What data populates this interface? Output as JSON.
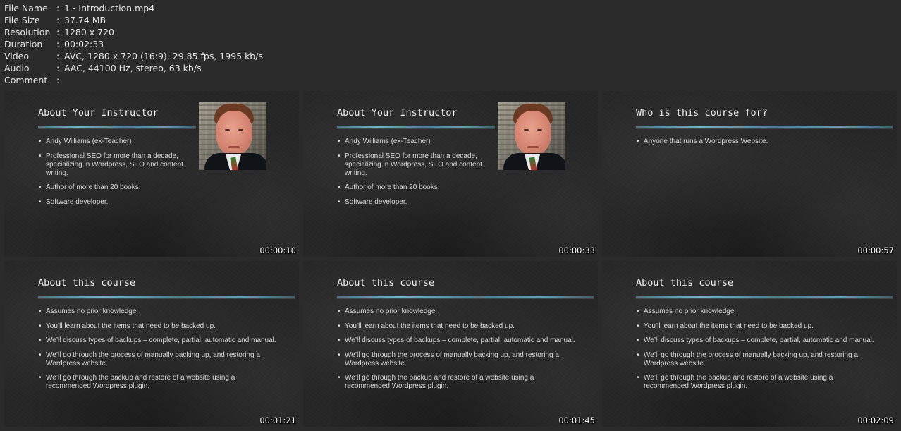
{
  "file_info": [
    {
      "label": "File Name",
      "value": "1 - Introduction.mp4"
    },
    {
      "label": "File Size",
      "value": "37.74 MB"
    },
    {
      "label": "Resolution",
      "value": "1280 x 720"
    },
    {
      "label": "Duration",
      "value": "00:02:33"
    },
    {
      "label": "Video",
      "value": "AVC, 1280 x 720 (16:9), 29.85 fps, 1995 kb/s"
    },
    {
      "label": "Audio",
      "value": "AAC, 44100 Hz, stereo, 63 kb/s"
    },
    {
      "label": "Comment",
      "value": ""
    }
  ],
  "separator": ":",
  "thumbnails": [
    {
      "timestamp": "00:00:10",
      "title": "About Your Instructor",
      "bullets": [
        "Andy Williams (ex-Teacher)",
        "Professional SEO for more than a decade, specializing in Wordpress, SEO and content writing.",
        "Author of more than 20 books.",
        "Software developer."
      ]
    },
    {
      "timestamp": "00:00:33",
      "title": "About Your Instructor",
      "bullets": [
        "Andy Williams (ex-Teacher)",
        "Professional SEO for more than a decade, specializing in Wordpress, SEO and content writing.",
        "Author of more than 20 books.",
        "Software developer."
      ]
    },
    {
      "timestamp": "00:00:57",
      "title": "Who is this course for?",
      "bullets": [
        "Anyone that runs a Wordpress Website."
      ]
    },
    {
      "timestamp": "00:01:21",
      "title": "About this course",
      "bullets": [
        "Assumes no prior knowledge.",
        "You’ll learn about the items that need to be backed up.",
        "We’ll discuss types of backups – complete, partial, automatic and manual.",
        "We’ll go through the process of manually backing up, and restoring a Wordpress website",
        "We’ll go through the backup and restore of a website using a recommended Wordpress plugin."
      ]
    },
    {
      "timestamp": "00:01:45",
      "title": "About this course",
      "bullets": [
        "Assumes no prior knowledge.",
        "You’ll learn about the items that need to be backed up.",
        "We’ll discuss types of backups – complete, partial, automatic and manual.",
        "We’ll go through the process of manually backing up, and restoring a Wordpress website",
        "We’ll go through the backup and restore of a website using a recommended Wordpress plugin."
      ]
    },
    {
      "timestamp": "00:02:09",
      "title": "About this course",
      "bullets": [
        "Assumes no prior knowledge.",
        "You’ll learn about the items that need to be backed up.",
        "We’ll discuss types of backups – complete, partial, automatic and manual.",
        "We’ll go through the process of manually backing up, and restoring a Wordpress website",
        "We’ll go through the backup and restore of a website using a recommended Wordpress plugin."
      ]
    }
  ]
}
